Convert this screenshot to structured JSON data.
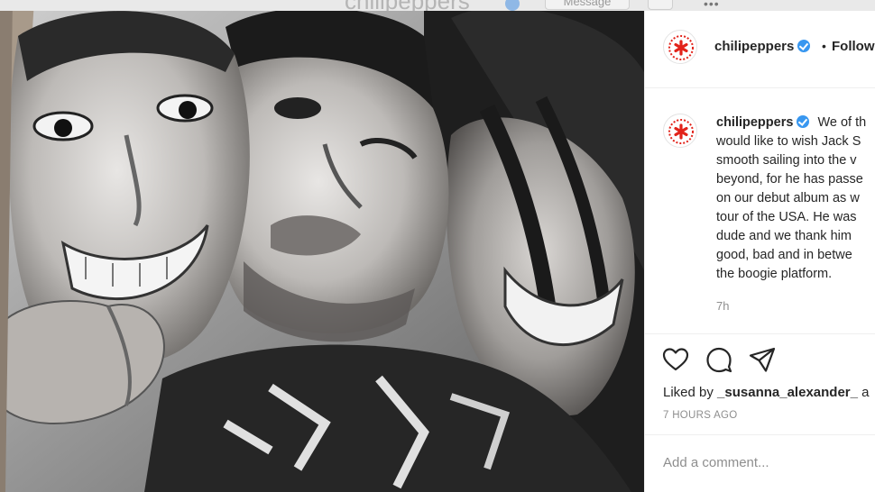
{
  "ghost_profile": {
    "username": "chilipeppers",
    "message_button": "Message"
  },
  "post": {
    "username": "chilipeppers",
    "separator": "•",
    "follow_label": "Follow",
    "caption": {
      "username": "chilipeppers",
      "lines": [
        "We of th",
        "would like to wish Jack S",
        "smooth sailing into the v",
        "beyond, for he has passe",
        "on our debut album as w",
        "tour of the USA. He was",
        "dude and we thank him",
        "good, bad and in betwe",
        "the boogie platform."
      ]
    },
    "time": "7h",
    "likes_prefix": "Liked by ",
    "likes_user": "_susanna_alexander_",
    "likes_suffix": " a",
    "ago": "7 HOURS AGO",
    "comment_placeholder": "Add a comment..."
  },
  "icons": {
    "like": "heart-icon",
    "comment": "comment-icon",
    "share": "share-icon",
    "verified": "verified-badge-icon",
    "avatar": "red-hot-chili-peppers-asterisk-logo"
  },
  "colors": {
    "verified": "#3897f0",
    "logo_red": "#e2231a",
    "muted_text": "#8e8e8e"
  }
}
